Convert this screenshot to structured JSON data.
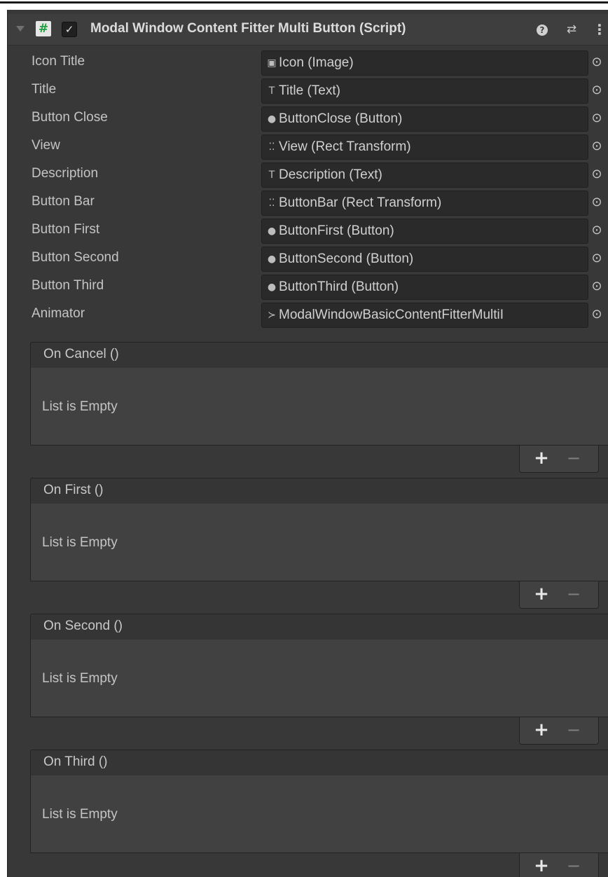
{
  "component": {
    "title": "Modal Window Content Fitter Multi Button (Script)",
    "enabled": "✓",
    "script_icon": "#",
    "help_icon": "?",
    "presets_icon": "⇄",
    "menu_icon": "⋮"
  },
  "fields": [
    {
      "label": "Icon Title",
      "icon": "image-icon",
      "glyph": "▣",
      "value": "Icon (Image)"
    },
    {
      "label": "Title",
      "icon": "text-icon",
      "glyph": "T",
      "value": "Title (Text)"
    },
    {
      "label": "Button Close",
      "icon": "button-icon",
      "glyph": "●",
      "value": "ButtonClose (Button)"
    },
    {
      "label": "View",
      "icon": "rect-transform-icon",
      "glyph": "⁚⁚",
      "value": "View (Rect Transform)"
    },
    {
      "label": "Description",
      "icon": "text-icon",
      "glyph": "T",
      "value": "Description (Text)"
    },
    {
      "label": "Button Bar",
      "icon": "rect-transform-icon",
      "glyph": "⁚⁚",
      "value": "ButtonBar (Rect Transform)"
    },
    {
      "label": "Button First",
      "icon": "button-icon",
      "glyph": "●",
      "value": "ButtonFirst (Button)"
    },
    {
      "label": "Button Second",
      "icon": "button-icon",
      "glyph": "●",
      "value": "ButtonSecond (Button)"
    },
    {
      "label": "Button Third",
      "icon": "button-icon",
      "glyph": "●",
      "value": "ButtonThird (Button)"
    },
    {
      "label": "Animator",
      "icon": "animator-icon",
      "glyph": "≻",
      "value": "ModalWindowBasicContentFitterMultiI"
    }
  ],
  "picker_glyph": "⊙",
  "events": [
    {
      "title": "On Cancel ()",
      "empty": "List is Empty"
    },
    {
      "title": "On First ()",
      "empty": "List is Empty"
    },
    {
      "title": "On Second ()",
      "empty": "List is Empty"
    },
    {
      "title": "On Third ()",
      "empty": "List is Empty"
    }
  ],
  "list_buttons": {
    "add": "+",
    "remove": "−"
  }
}
